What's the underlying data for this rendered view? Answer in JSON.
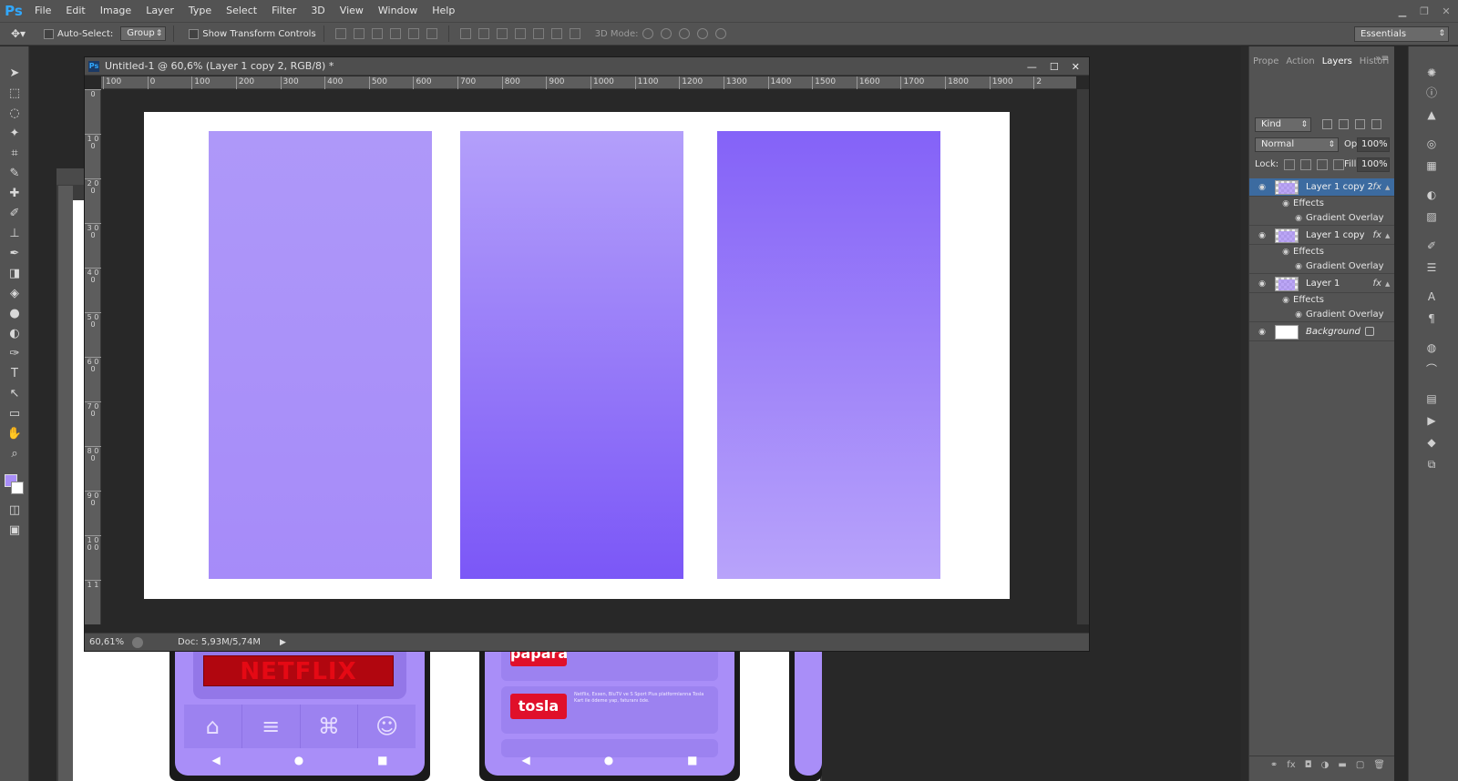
{
  "app": {
    "logo": "Ps",
    "menu": [
      "File",
      "Edit",
      "Image",
      "Layer",
      "Type",
      "Select",
      "Filter",
      "3D",
      "View",
      "Window",
      "Help"
    ]
  },
  "options_bar": {
    "auto_select_label": "Auto-Select:",
    "auto_select_value": "Group",
    "transform_label": "Show Transform Controls",
    "mode3d_label": "3D Mode:",
    "workspace": "Essentials"
  },
  "document": {
    "title": "Untitled-1 @ 60,6% (Layer 1 copy 2, RGB/8) *",
    "ruler_top": [
      "100",
      "0",
      "100",
      "200",
      "300",
      "400",
      "500",
      "600",
      "700",
      "800",
      "900",
      "1000",
      "1100",
      "1200",
      "1300",
      "1400",
      "1500",
      "1600",
      "1700",
      "1800",
      "1900",
      "2"
    ],
    "ruler_left": [
      "0",
      "1 0 0",
      "2 0 0",
      "3 0 0",
      "4 0 0",
      "5 0 0",
      "6 0 0",
      "7 0 0",
      "8 0 0",
      "9 0 0",
      "1 0 0 0",
      "1 1"
    ],
    "zoom": "60,61%",
    "doc_info": "Doc: 5,93M/5,74M",
    "panels": [
      {
        "gradient_from": "#ae98f9",
        "gradient_to": "#a68bf9"
      },
      {
        "gradient_from": "#b39ffa",
        "gradient_to": "#7b57f7"
      },
      {
        "gradient_from": "#8462f8",
        "gradient_to": "#b8a3fa"
      }
    ]
  },
  "background_doc": {
    "netflix_label": "NETFLIX",
    "papara_label": "papara",
    "tosla_label": "tosla",
    "tosla_text": "Netflix, Exxen, BluTV ve S Sport Plus platformlarına Tosla Kart ile ödeme yap, faturanı öde."
  },
  "layers_panel": {
    "tabs": [
      "Prope",
      "Action",
      "Layers",
      "Histori"
    ],
    "active_tab": "Layers",
    "kind_label": "Kind",
    "blend_mode": "Normal",
    "opacity_label": "Opacity:",
    "opacity_value": "100%",
    "lock_label": "Lock:",
    "fill_label": "Fill:",
    "fill_value": "100%",
    "layers": [
      {
        "name": "Layer 1 copy 2",
        "effects": "Effects",
        "overlay": "Gradient Overlay",
        "selected": true
      },
      {
        "name": "Layer 1 copy",
        "effects": "Effects",
        "overlay": "Gradient Overlay",
        "selected": false
      },
      {
        "name": "Layer 1",
        "effects": "Effects",
        "overlay": "Gradient Overlay",
        "selected": false
      }
    ],
    "background_layer": "Background",
    "fx_label": "fx"
  },
  "colors": {
    "foreground": "#a98ef8",
    "background": "#ffffff",
    "selection": "#3c6ba0"
  }
}
